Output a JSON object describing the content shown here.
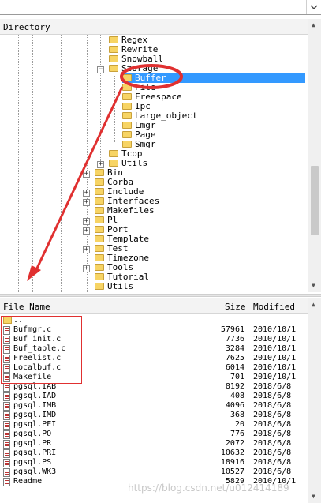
{
  "address": {
    "value": ""
  },
  "tree_header": {
    "title": "Directory"
  },
  "tree": [
    {
      "label": "Regex"
    },
    {
      "label": "Rewrite"
    },
    {
      "label": "Snowball"
    },
    {
      "label": "Storage",
      "expanded": true
    },
    {
      "label": "Buffer",
      "selected": true
    },
    {
      "label": "File"
    },
    {
      "label": "Freespace"
    },
    {
      "label": "Ipc"
    },
    {
      "label": "Large_object"
    },
    {
      "label": "Lmgr"
    },
    {
      "label": "Page"
    },
    {
      "label": "Smgr"
    },
    {
      "label": "Tcop"
    },
    {
      "label": "Utils"
    },
    {
      "label": "Bin"
    },
    {
      "label": "Corba"
    },
    {
      "label": "Include"
    },
    {
      "label": "Interfaces"
    },
    {
      "label": "Makefiles"
    },
    {
      "label": "Pl"
    },
    {
      "label": "Port"
    },
    {
      "label": "Template"
    },
    {
      "label": "Test"
    },
    {
      "label": "Timezone"
    },
    {
      "label": "Tools"
    },
    {
      "label": "Tutorial"
    },
    {
      "label": "Utils"
    }
  ],
  "file_header": {
    "name": "File Name",
    "size": "Size",
    "modified": "Modified"
  },
  "files": [
    {
      "name": "..",
      "size": "",
      "modified": "",
      "type": "dir"
    },
    {
      "name": "Bufmgr.c",
      "size": "57961",
      "modified": "2010/10/1"
    },
    {
      "name": "Buf_init.c",
      "size": "7736",
      "modified": "2010/10/1"
    },
    {
      "name": "Buf_table.c",
      "size": "3284",
      "modified": "2010/10/1"
    },
    {
      "name": "Freelist.c",
      "size": "7625",
      "modified": "2010/10/1"
    },
    {
      "name": "Localbuf.c",
      "size": "6014",
      "modified": "2010/10/1"
    },
    {
      "name": "Makefile",
      "size": "701",
      "modified": "2010/10/1"
    },
    {
      "name": "pgsql.IAB",
      "size": "8192",
      "modified": "2018/6/8"
    },
    {
      "name": "pgsql.IAD",
      "size": "408",
      "modified": "2018/6/8"
    },
    {
      "name": "pgsql.IMB",
      "size": "4096",
      "modified": "2018/6/8"
    },
    {
      "name": "pgsql.IMD",
      "size": "368",
      "modified": "2018/6/8"
    },
    {
      "name": "pgsql.PFI",
      "size": "20",
      "modified": "2018/6/8"
    },
    {
      "name": "pgsql.PO",
      "size": "776",
      "modified": "2018/6/8"
    },
    {
      "name": "pgsql.PR",
      "size": "2072",
      "modified": "2018/6/8"
    },
    {
      "name": "pgsql.PRI",
      "size": "10632",
      "modified": "2018/6/8"
    },
    {
      "name": "pgsql.PS",
      "size": "18916",
      "modified": "2018/6/8"
    },
    {
      "name": "pgsql.WK3",
      "size": "10527",
      "modified": "2018/6/8"
    },
    {
      "name": "Readme",
      "size": "5829",
      "modified": "2010/10/1"
    }
  ],
  "watermark": "https://blog.csdn.net/u012414189",
  "colors": {
    "selection": "#3399ff",
    "annotation": "#e03030"
  }
}
